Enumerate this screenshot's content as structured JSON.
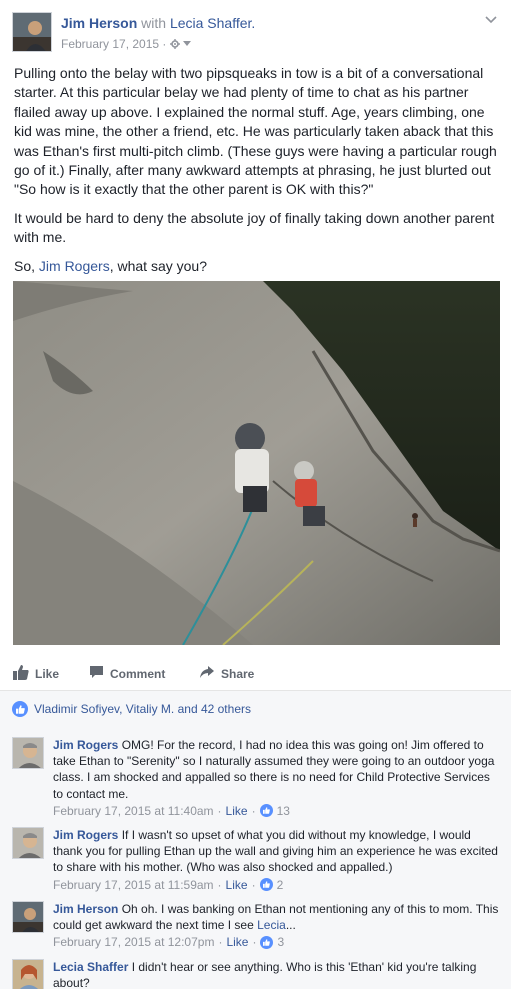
{
  "post": {
    "author": "Jim Herson",
    "with_word": "with",
    "tagged": "Lecia Shaffer.",
    "date": "February 17, 2015",
    "audience_icon": "gear-icon",
    "paragraph1": "Pulling onto the belay with two pipsqueaks in tow is a bit of a conversational starter. At this particular belay we had plenty of time to chat as his partner flailed away up above. I explained the normal stuff. Age, years climbing, one kid was mine, the other a friend, etc. He was particularly taken aback that this was Ethan's first multi-pitch climb. (These guys were having a particular rough go of it.) Finally, after many awkward attempts at phrasing, he just blurted out \"So how is it exactly that the other parent is OK with this?\"",
    "paragraph2": "It would be hard to deny the absolute joy of finally taking down another parent with me.",
    "paragraph3_prefix": "So,",
    "paragraph3_mention": "Jim Rogers",
    "paragraph3_suffix": ", what say you?"
  },
  "actions": {
    "like": "Like",
    "comment": "Comment",
    "share": "Share"
  },
  "reactions": {
    "summary": "Vladimir Sofiyev, Vitaliy M. and 42 others"
  },
  "comments": [
    {
      "name": "Jim Rogers",
      "text": "OMG! For the record, I had no idea this was going on! Jim offered to take Ethan to \"Serenity\" so I naturally assumed they were going to an outdoor yoga class. I am shocked and appalled so there is no need for Child Protective Services to contact me.",
      "time": "February 17, 2015 at 11:40am",
      "like_label": "Like",
      "like_count": "13"
    },
    {
      "name": "Jim Rogers",
      "text": "If I wasn't so upset of what you did without my knowledge, I would thank you for pulling Ethan up the wall and giving him an experience he was excited to share with his mother. (Who was also shocked and appalled.)",
      "time": "February 17, 2015 at 11:59am",
      "like_label": "Like",
      "like_count": "2"
    },
    {
      "name": "Jim Herson",
      "text": "Oh oh. I was banking on Ethan not mentioning any of this to mom. This could get awkward the next time I see",
      "mention": "Lecia",
      "text_suffix": "...",
      "time": "February 17, 2015 at 12:07pm",
      "like_label": "Like",
      "like_count": "3"
    },
    {
      "name": "Lecia Shaffer",
      "text": "I didn't hear or see anything. Who is this 'Ethan' kid you're talking about?"
    }
  ],
  "colors": {
    "link": "#365899",
    "muted": "#90949c",
    "text": "#1d2129",
    "like_blue": "#5890ff",
    "comment_bg": "#f6f7f9"
  }
}
